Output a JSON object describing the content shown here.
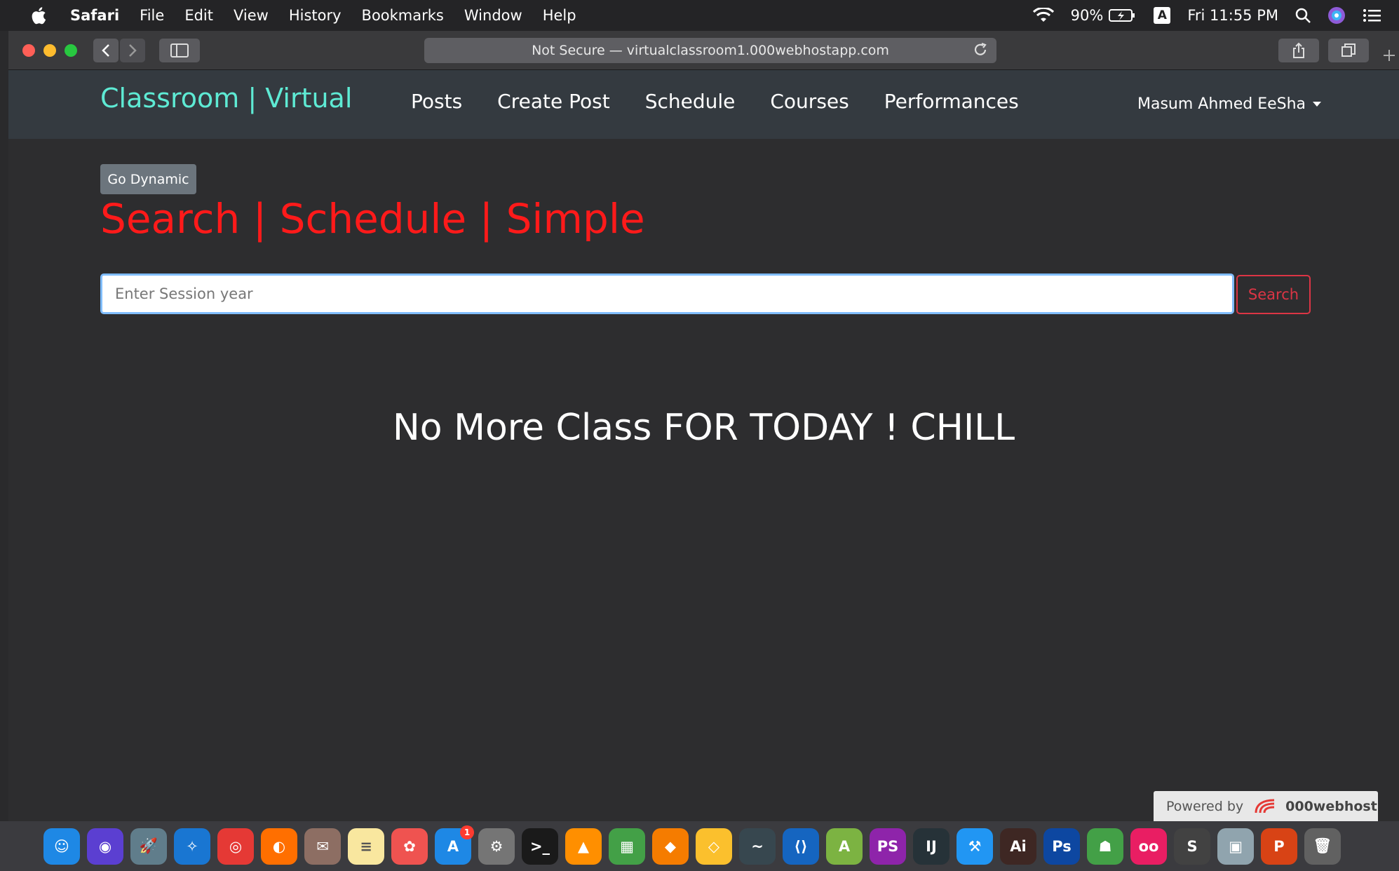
{
  "menubar": {
    "app": "Safari",
    "items": [
      "File",
      "Edit",
      "View",
      "History",
      "Bookmarks",
      "Window",
      "Help"
    ],
    "battery": "90%",
    "input_source": "A",
    "clock": "Fri 11:55 PM"
  },
  "browser": {
    "address": "Not Secure — virtualclassroom1.000webhostapp.com"
  },
  "site": {
    "brand": "Classroom | Virtual",
    "nav": [
      "Posts",
      "Create Post",
      "Schedule",
      "Courses",
      "Performances"
    ],
    "user": "Masum Ahmed EeSha",
    "go_dynamic": "Go Dynamic",
    "headline": "Search | Schedule | Simple",
    "search_placeholder": "Enter Session year",
    "search_button": "Search",
    "message": "No More Class FOR TODAY ! CHILL",
    "powered_label": "Powered by",
    "powered_brand": "000webhost"
  },
  "dock": {
    "apps": [
      {
        "name": "finder",
        "color": "#1e88e5",
        "glyph": "☺"
      },
      {
        "name": "siri",
        "color": "#5b3fd1",
        "glyph": "◉"
      },
      {
        "name": "launchpad",
        "color": "#607d8b",
        "glyph": "🚀"
      },
      {
        "name": "safari",
        "color": "#1976d2",
        "glyph": "✧"
      },
      {
        "name": "chrome",
        "color": "#e53935",
        "glyph": "◎"
      },
      {
        "name": "firefox",
        "color": "#ff6f00",
        "glyph": "◐"
      },
      {
        "name": "mail",
        "color": "#8d6e63",
        "glyph": "✉"
      },
      {
        "name": "notes",
        "color": "#f9e79f",
        "glyph": "≡"
      },
      {
        "name": "photos",
        "color": "#ef5350",
        "glyph": "✿"
      },
      {
        "name": "app-store",
        "color": "#1e88e5",
        "glyph": "A",
        "badge": "1"
      },
      {
        "name": "system-preferences",
        "color": "#757575",
        "glyph": "⚙"
      },
      {
        "name": "terminal",
        "color": "#1a1a1a",
        "glyph": ">_"
      },
      {
        "name": "vlc",
        "color": "#ff8f00",
        "glyph": "▲"
      },
      {
        "name": "microsoft",
        "color": "#43a047",
        "glyph": "▦"
      },
      {
        "name": "sequel-pro",
        "color": "#f57c00",
        "glyph": "◆"
      },
      {
        "name": "sketch",
        "color": "#fbc02d",
        "glyph": "◇"
      },
      {
        "name": "mysql-workbench",
        "color": "#37474f",
        "glyph": "~"
      },
      {
        "name": "vscode",
        "color": "#1565c0",
        "glyph": "⟨⟩"
      },
      {
        "name": "android-studio",
        "color": "#7cb342",
        "glyph": "A"
      },
      {
        "name": "phpstorm",
        "color": "#8e24aa",
        "glyph": "PS"
      },
      {
        "name": "intellij",
        "color": "#263238",
        "glyph": "IJ"
      },
      {
        "name": "xcode",
        "color": "#2196f3",
        "glyph": "⚒"
      },
      {
        "name": "illustrator",
        "color": "#3e2723",
        "glyph": "Ai"
      },
      {
        "name": "photoshop",
        "color": "#0d47a1",
        "glyph": "Ps"
      },
      {
        "name": "android-file-transfer",
        "color": "#43a047",
        "glyph": "☗"
      },
      {
        "name": "app-oo",
        "color": "#e91e63",
        "glyph": "oo"
      },
      {
        "name": "sublime-text",
        "color": "#424242",
        "glyph": "S"
      },
      {
        "name": "archive-utility",
        "color": "#90a4ae",
        "glyph": "▣"
      },
      {
        "name": "powerpoint",
        "color": "#d84315",
        "glyph": "P"
      },
      {
        "name": "trash",
        "color": "#616161",
        "glyph": "🗑"
      }
    ]
  }
}
